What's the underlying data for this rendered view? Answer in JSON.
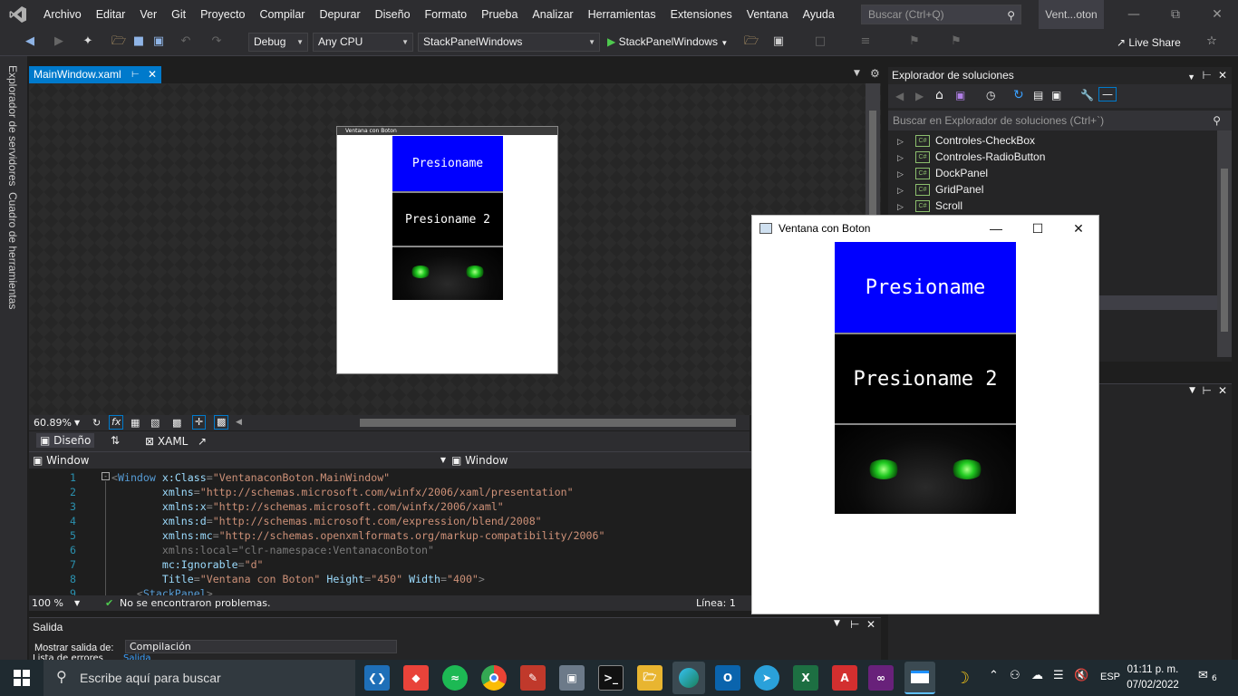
{
  "menubar": {
    "items": [
      "Archivo",
      "Editar",
      "Ver",
      "Git",
      "Proyecto",
      "Compilar",
      "Depurar",
      "Diseño",
      "Formato",
      "Prueba",
      "Analizar",
      "Herramientas",
      "Extensiones",
      "Ventana",
      "Ayuda"
    ],
    "search_placeholder": "Buscar (Ctrl+Q)",
    "window_title": "Vent...oton"
  },
  "toolbar": {
    "config": "Debug",
    "platform": "Any CPU",
    "project": "StackPanelWindows",
    "run_label": "StackPanelWindows",
    "live_share": "Live Share"
  },
  "left_tabs": [
    "Explorador de servidores",
    "Cuadro de herramientas"
  ],
  "document_tab": "MainWindow.xaml",
  "designer": {
    "preview_title": "Ventana con Boton",
    "zoom": "60.89%",
    "design_tab": "Diseño",
    "xaml_tab": "XAML"
  },
  "editor_header": {
    "left": "Window",
    "right": "Window"
  },
  "code_lines": [
    {
      "n": "1",
      "parts": [
        [
          "pun",
          "<"
        ],
        [
          "tag",
          "Window "
        ],
        [
          "attr",
          "x:Class"
        ],
        [
          "pun",
          "="
        ],
        [
          "val",
          "\"VentanaconBoton.MainWindow\""
        ]
      ]
    },
    {
      "n": "2",
      "parts": [
        [
          "pad",
          "        "
        ],
        [
          "attr",
          "xmlns"
        ],
        [
          "pun",
          "="
        ],
        [
          "val",
          "\"http://schemas.microsoft.com/winfx/2006/xaml/presentation\""
        ]
      ]
    },
    {
      "n": "3",
      "parts": [
        [
          "pad",
          "        "
        ],
        [
          "attr",
          "xmlns:x"
        ],
        [
          "pun",
          "="
        ],
        [
          "val",
          "\"http://schemas.microsoft.com/winfx/2006/xaml\""
        ]
      ]
    },
    {
      "n": "4",
      "parts": [
        [
          "pad",
          "        "
        ],
        [
          "attr",
          "xmlns:d"
        ],
        [
          "pun",
          "="
        ],
        [
          "val",
          "\"http://schemas.microsoft.com/expression/blend/2008\""
        ]
      ]
    },
    {
      "n": "5",
      "parts": [
        [
          "pad",
          "        "
        ],
        [
          "attr",
          "xmlns:mc"
        ],
        [
          "pun",
          "="
        ],
        [
          "val",
          "\"http://schemas.openxmlformats.org/markup-compatibility/2006\""
        ]
      ]
    },
    {
      "n": "6",
      "parts": [
        [
          "pad",
          "        "
        ],
        [
          "dim",
          "xmlns:local=\"clr-namespace:VentanaconBoton\""
        ]
      ]
    },
    {
      "n": "7",
      "parts": [
        [
          "pad",
          "        "
        ],
        [
          "attr",
          "mc:Ignorable"
        ],
        [
          "pun",
          "="
        ],
        [
          "val",
          "\"d\""
        ]
      ]
    },
    {
      "n": "8",
      "parts": [
        [
          "pad",
          "        "
        ],
        [
          "attr",
          "Title"
        ],
        [
          "pun",
          "="
        ],
        [
          "val",
          "\"Ventana con Boton\""
        ],
        [
          "attr",
          " Height"
        ],
        [
          "pun",
          "="
        ],
        [
          "val",
          "\"450\""
        ],
        [
          "attr",
          " Width"
        ],
        [
          "pun",
          "="
        ],
        [
          "val",
          "\"400\""
        ],
        [
          "pun",
          ">"
        ]
      ]
    },
    {
      "n": "9",
      "parts": [
        [
          "pad",
          "    "
        ],
        [
          "pun",
          "<"
        ],
        [
          "tag",
          "StackPanel"
        ],
        [
          "pun",
          ">"
        ]
      ]
    }
  ],
  "statusbar": {
    "zoom": "100 %",
    "issues": "No se encontraron problemas.",
    "line": "Línea: 1"
  },
  "output": {
    "title": "Salida",
    "show_from": "Mostrar salida de:",
    "source": "Compilación",
    "tabs": [
      "Lista de errores",
      "Salida"
    ]
  },
  "solution_explorer": {
    "title": "Explorador de soluciones",
    "search": "Buscar en Explorador de soluciones (Ctrl+`)",
    "items": [
      "Controles-CheckBox",
      "Controles-RadioButton",
      "DockPanel",
      "GridPanel",
      "Scroll"
    ]
  },
  "running_window": {
    "title": "Ventana con Boton",
    "button1": "Presioname",
    "button2": "Presioname 2"
  },
  "taskbar": {
    "search": "Escribe aquí para buscar",
    "lang": "ESP",
    "time": "01:11 p. m.",
    "date": "07/02/2022",
    "notifications": "6"
  },
  "colors": {
    "accent": "#007acc",
    "button_blue": "#0000ff",
    "vs_purple": "#68217a"
  }
}
